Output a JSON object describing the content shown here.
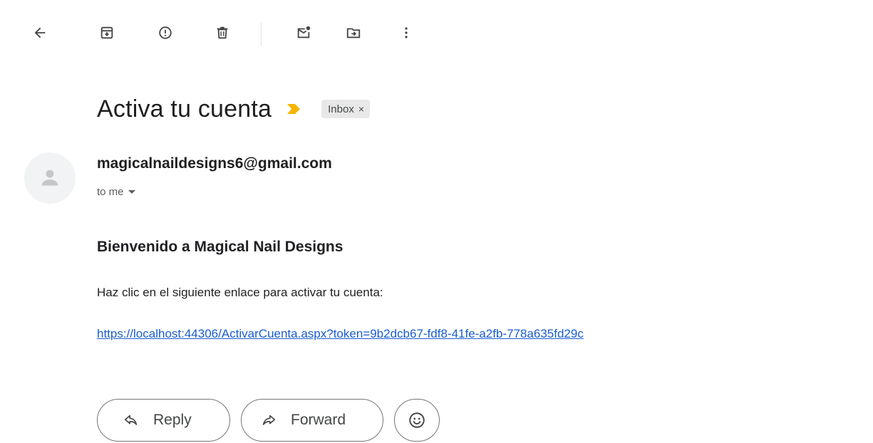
{
  "toolbar": {
    "items": [
      "back-icon",
      "archive-icon",
      "report-spam-icon",
      "delete-icon",
      "mark-unread-icon",
      "move-to-icon",
      "more-options-icon"
    ]
  },
  "message": {
    "subject": "Activa tu cuenta",
    "importance_color": "#f5b400",
    "label": "Inbox",
    "label_remove": "×",
    "sender": "magicalnaildesigns6@gmail.com",
    "recipient": "to me",
    "body": {
      "heading": "Bienvenido a Magical Nail Designs",
      "paragraph": "Haz clic en el siguiente enlace para activar tu cuenta:",
      "link": "https://localhost:44306/ActivarCuenta.aspx?token=9b2dcb67-fdf8-41fe-a2fb-778a635fd29c"
    }
  },
  "actions": {
    "reply": "Reply",
    "forward": "Forward",
    "emoji_icon": "smiley-icon"
  },
  "colors": {
    "link": "#1a5dce",
    "chip_bg": "#e8e8e8",
    "text": "#1f1f1f"
  }
}
